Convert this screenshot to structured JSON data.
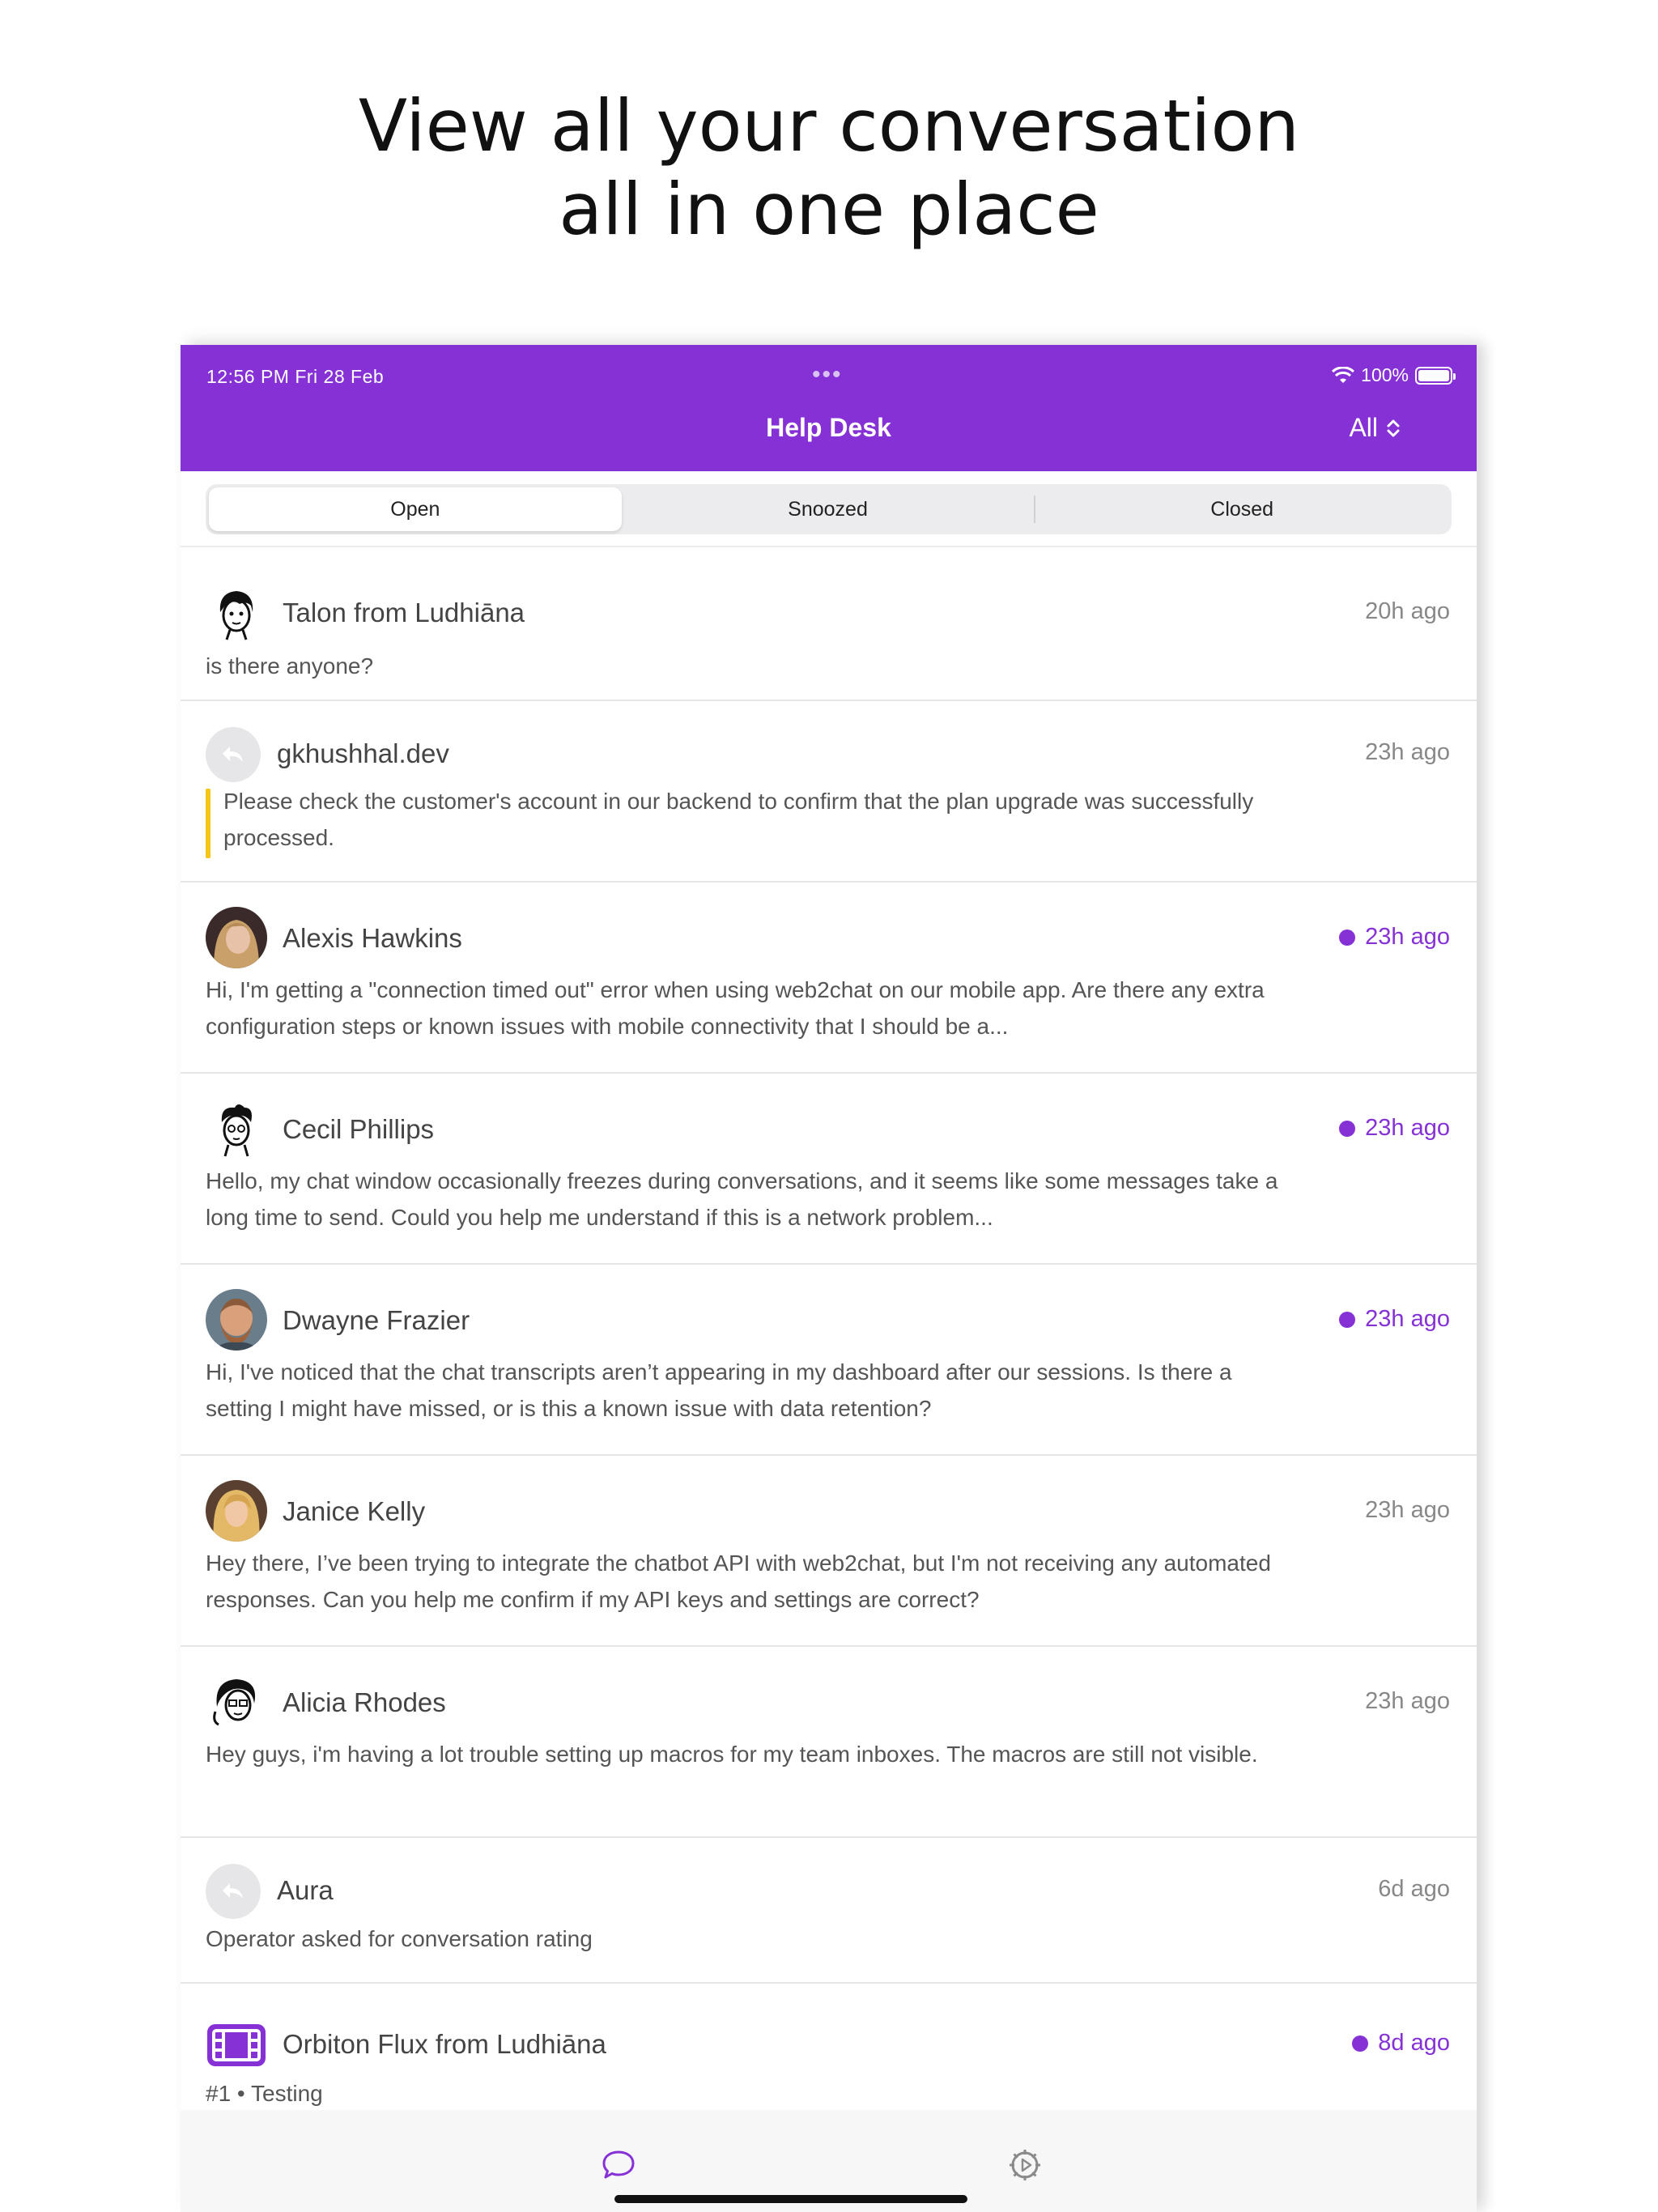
{
  "headline": {
    "line1": "View all your conversation",
    "line2": "all in one place"
  },
  "status_bar": {
    "time": "12:56 PM   Fri 28 Feb",
    "battery": "100%"
  },
  "app_bar": {
    "title": "Help Desk",
    "filter_label": "All"
  },
  "tabs": [
    {
      "label": "Open",
      "active": true
    },
    {
      "label": "Snoozed",
      "active": false
    },
    {
      "label": "Closed",
      "active": false
    }
  ],
  "conversations": [
    {
      "name": "Talon from Ludhiāna",
      "time": "20h ago",
      "unread": false,
      "avatar": "sketch-avatar",
      "preview": "is there anyone?"
    },
    {
      "name": "gkhushhal.dev",
      "time": "23h ago",
      "unread": false,
      "avatar": "reply-icon",
      "preview": "Please check the customer's account in our backend to confirm that the plan upgrade was successfully processed.",
      "private_note": true
    },
    {
      "name": "Alexis Hawkins",
      "time": "23h ago",
      "unread": true,
      "avatar": "photo-avatar",
      "preview": "Hi, I'm getting a \"connection timed out\" error when using web2chat on our mobile app. Are there any extra configuration steps or known issues with mobile connectivity that I should be a..."
    },
    {
      "name": "Cecil Phillips",
      "time": "23h ago",
      "unread": true,
      "avatar": "sketch-avatar",
      "preview": "Hello, my chat window occasionally freezes during conversations, and it seems like some messages take a long time to send. Could you help me understand if this is a network problem..."
    },
    {
      "name": "Dwayne Frazier",
      "time": "23h ago",
      "unread": true,
      "avatar": "photo-avatar",
      "preview": "Hi, I've noticed that the chat transcripts aren’t appearing in my dashboard after our sessions. Is there a setting I might have missed, or is this a known issue with data retention?"
    },
    {
      "name": "Janice Kelly",
      "time": "23h ago",
      "unread": false,
      "avatar": "photo-avatar",
      "preview": "Hey there, I’ve been trying to integrate the chatbot API with web2chat, but I'm not receiving any automated responses. Can you help me confirm if my API keys and settings are correct?"
    },
    {
      "name": "Alicia Rhodes",
      "time": "23h ago",
      "unread": false,
      "avatar": "sketch-avatar",
      "preview": "Hey guys, i'm having a lot trouble setting up macros for my team inboxes. The macros are still not visible."
    },
    {
      "name": "Aura",
      "time": "6d ago",
      "unread": false,
      "avatar": "reply-icon",
      "preview": "Operator asked for conversation rating"
    },
    {
      "name": "Orbiton Flux from Ludhiāna",
      "time": "8d ago",
      "unread": true,
      "avatar": "film-icon",
      "preview": "#1 • Testing"
    }
  ],
  "colors": {
    "brand": "#8631d6",
    "note_bar": "#f5c518",
    "unread_dot": "#8631d6"
  },
  "bottom_tabs": [
    {
      "icon": "chat-bubble-icon",
      "active": true
    },
    {
      "icon": "settings-gear-icon",
      "active": false
    }
  ]
}
